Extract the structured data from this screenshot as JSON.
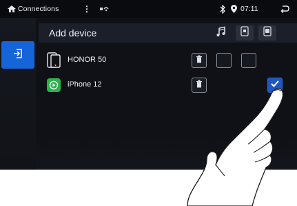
{
  "statusbar": {
    "title": "Connections",
    "menu_glyph": "⋮",
    "time": "07:11"
  },
  "header": {
    "title": "Add device"
  },
  "devices": [
    {
      "name": "HONOR 50",
      "icon": "phone-outline-icon",
      "checkboxes": [
        false,
        false
      ]
    },
    {
      "name": "iPhone 12",
      "icon": "carplay-icon",
      "checked": true
    }
  ],
  "colors": {
    "accent": "#1665d8",
    "carplay_green": "#2bb24c",
    "background": "#0f1116"
  }
}
